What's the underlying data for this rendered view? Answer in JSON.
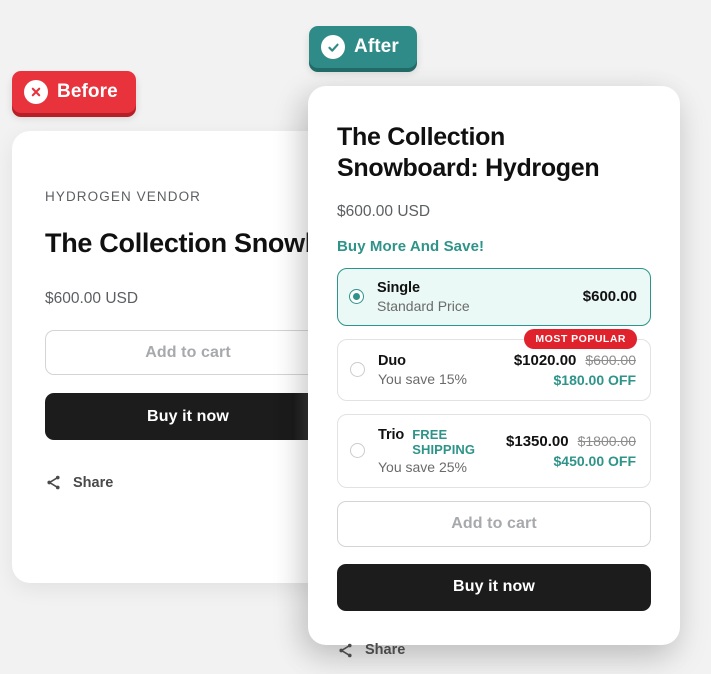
{
  "badges": {
    "before": {
      "label": "Before",
      "icon": "x-circle-icon",
      "color": "#e8323c"
    },
    "after": {
      "label": "After",
      "icon": "check-circle-icon",
      "color": "#2e8b87"
    }
  },
  "before_card": {
    "vendor": "HYDROGEN VENDOR",
    "title": "The Collection Snowboard: Hydrogen",
    "price": "$600.00 USD",
    "add_to_cart_label": "Add to cart",
    "buy_now_label": "Buy it now",
    "share_label": "Share",
    "share_icon": "share-nodes-icon"
  },
  "after_card": {
    "title": "The Collection Snowboard: Hydrogen",
    "price": "$600.00 USD",
    "offer_heading": "Buy More And Save!",
    "options": [
      {
        "name": "Single",
        "tag": "",
        "subtitle": "Standard Price",
        "price": "$600.00",
        "compare_at": "",
        "savings": "",
        "badge": "",
        "selected": true
      },
      {
        "name": "Duo",
        "tag": "",
        "subtitle": "You save 15%",
        "price": "$1020.00",
        "compare_at": "$600.00",
        "savings": "$180.00 OFF",
        "badge": "MOST POPULAR",
        "selected": false
      },
      {
        "name": "Trio",
        "tag": "FREE SHIPPING",
        "subtitle": "You save 25%",
        "price": "$1350.00",
        "compare_at": "$1800.00",
        "savings": "$450.00 OFF",
        "badge": "",
        "selected": false
      }
    ],
    "add_to_cart_label": "Add to cart",
    "buy_now_label": "Buy it now",
    "share_label": "Share",
    "share_icon": "share-nodes-icon"
  },
  "colors": {
    "background": "#f2f2f2",
    "accent_teal": "#2e9489",
    "accent_red": "#e0222c",
    "dark_button": "#1c1c1c",
    "selected_option_bg": "#eaf8f6"
  }
}
